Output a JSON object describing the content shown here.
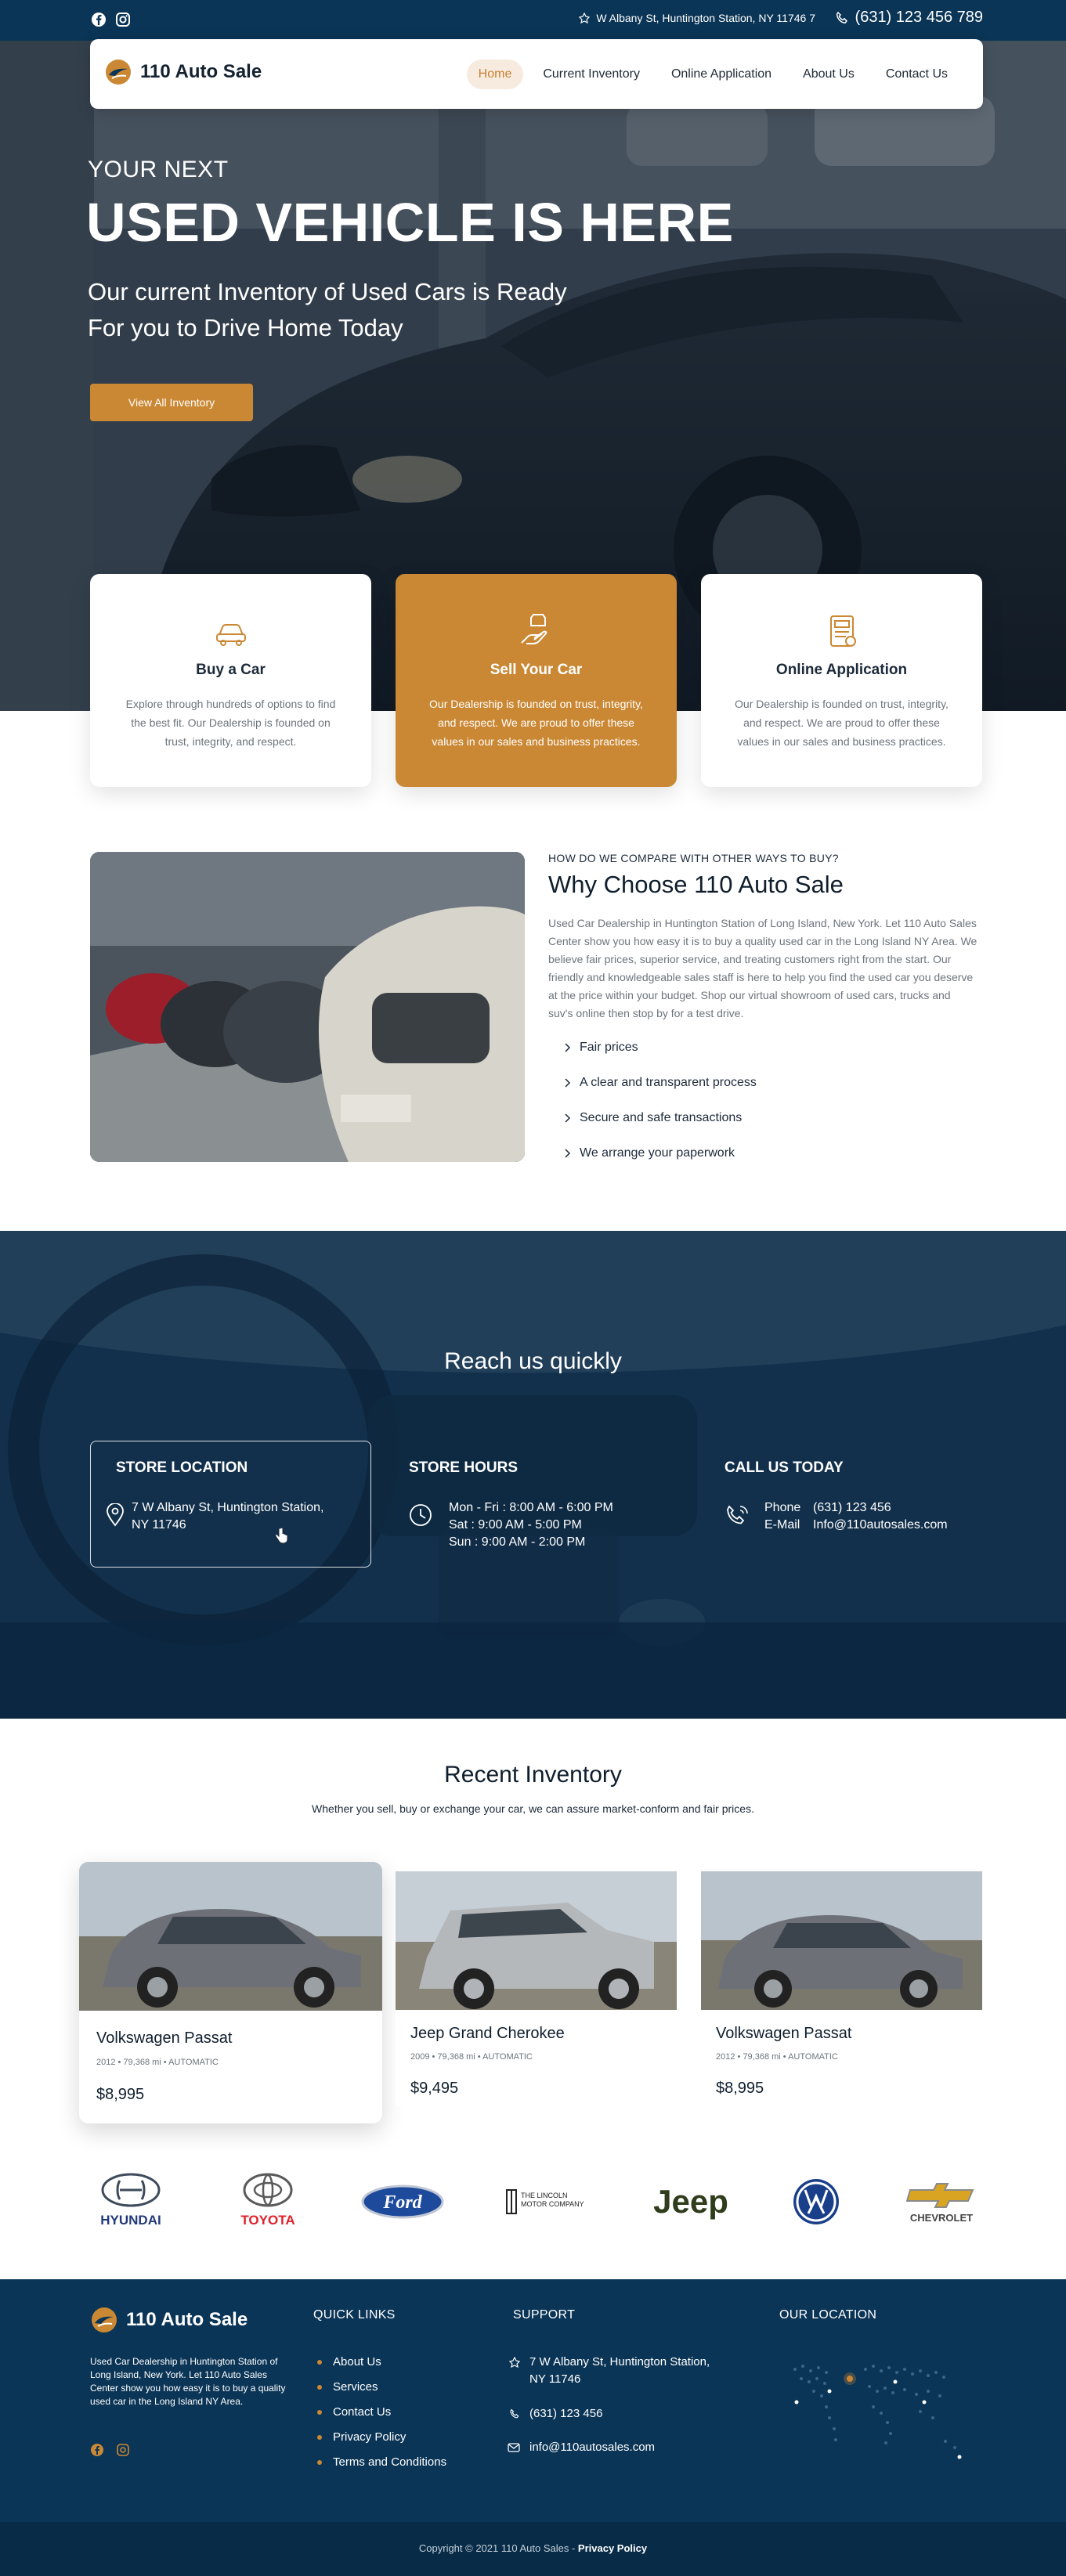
{
  "topbar": {
    "address": "W Albany St, Huntington Station, NY 11746 7",
    "phone": "(631) 123 456 789",
    "social_icons": [
      "facebook-icon",
      "instagram-icon"
    ]
  },
  "brand": {
    "name": "110 Auto Sale",
    "accent": "#cb8834",
    "navy": "#0b3556"
  },
  "nav": {
    "items": [
      {
        "label": "Home",
        "active": true
      },
      {
        "label": "Current Inventory",
        "active": false
      },
      {
        "label": "Online Application",
        "active": false
      },
      {
        "label": "About Us",
        "active": false
      },
      {
        "label": "Contact Us",
        "active": false
      }
    ]
  },
  "hero": {
    "pretitle": "YOUR NEXT",
    "title": "USED VEHICLE IS HERE",
    "subtitle_line1": "Our current Inventory of Used Cars is Ready",
    "subtitle_line2": "For you to Drive Home Today",
    "button": "View All Inventory"
  },
  "features": [
    {
      "icon": "car-icon",
      "title": "Buy a Car",
      "text": "Explore through hundreds of options to find the best fit. Our Dealership is founded on trust, integrity, and respect."
    },
    {
      "icon": "hand-car-icon",
      "title": "Sell Your Car",
      "text": "Our Dealership is founded on trust, integrity, and respect. We are proud to offer these values in our sales and business practices."
    },
    {
      "icon": "application-icon",
      "title": "Online Application",
      "text": "Our Dealership is founded on trust, integrity, and respect. We are proud to offer these values in our sales and business practices."
    }
  ],
  "why": {
    "kicker": "HOW DO WE COMPARE WITH OTHER WAYS TO BUY?",
    "title": "Why Choose 110 Auto Sale",
    "paragraph": "Used Car Dealership in Huntington Station of Long Island, New York.  Let 110 Auto Sales Center show you how easy it is to buy a quality used car in the Long Island NY Area. We believe fair prices, superior service, and treating customers right from the start. Our friendly and knowledgeable sales staff is here to help you find the used car you deserve at the price within your budget. Shop our virtual showroom of used cars, trucks and suv's online then stop by for a test drive.",
    "points": [
      "Fair prices",
      "A clear and transparent process",
      "Secure and safe transactions",
      "We arrange your paperwork"
    ]
  },
  "reach": {
    "title": "Reach us quickly",
    "store": {
      "heading": "STORE LOCATION",
      "line1": "7 W Albany St, Huntington Station,",
      "line2": "NY 11746"
    },
    "hours": {
      "heading": "STORE HOURS",
      "lines": [
        "Mon - Fri : 8:00 AM - 6:00 PM",
        "Sat : 9:00 AM - 5:00 PM",
        "Sun : 9:00 AM - 2:00 PM"
      ]
    },
    "call": {
      "heading": "CALL US TODAY",
      "phone_label": "Phone",
      "phone": "(631) 123 456",
      "email_label": "E-Mail",
      "email": "Info@110autosales.com"
    }
  },
  "inventory": {
    "title": "Recent Inventory",
    "subtitle": "Whether you sell, buy or exchange your car, we can assure market-conform and fair prices.",
    "cars": [
      {
        "name": "Volkswagen Passat",
        "meta": "2012 • 79,368 mi • AUTOMATIC",
        "price": "$8,995"
      },
      {
        "name": "Jeep Grand Cherokee",
        "meta": "2009 • 79,368 mi • AUTOMATIC",
        "price": "$9,495"
      },
      {
        "name": "Volkswagen Passat",
        "meta": "2012 • 79,368 mi • AUTOMATIC",
        "price": "$8,995"
      }
    ]
  },
  "brands": [
    "HYUNDAI",
    "TOYOTA",
    "Ford",
    "THE LINCOLN MOTOR COMPANY",
    "Jeep",
    "VW",
    "CHEVROLET"
  ],
  "footer": {
    "about": "Used Car Dealership in Huntington Station of Long Island, New York.  Let 110 Auto Sales Center show you how easy it is to buy a quality used car in the Long Island NY Area.",
    "quick_links_heading": "QUICK LINKS",
    "quick_links": [
      "About Us",
      "Services",
      "Contact Us",
      "Privacy Policy",
      "Terms and Conditions"
    ],
    "support_heading": "SUPPORT",
    "support_address1": "7 W Albany St, Huntington Station,",
    "support_address2": "NY 11746",
    "support_phone": "(631) 123 456",
    "support_email": "info@110autosales.com",
    "location_heading": "OUR LOCATION",
    "copyright": "Copyright © 2021 110 Auto Sales -",
    "privacy": "Privacy Policy"
  }
}
